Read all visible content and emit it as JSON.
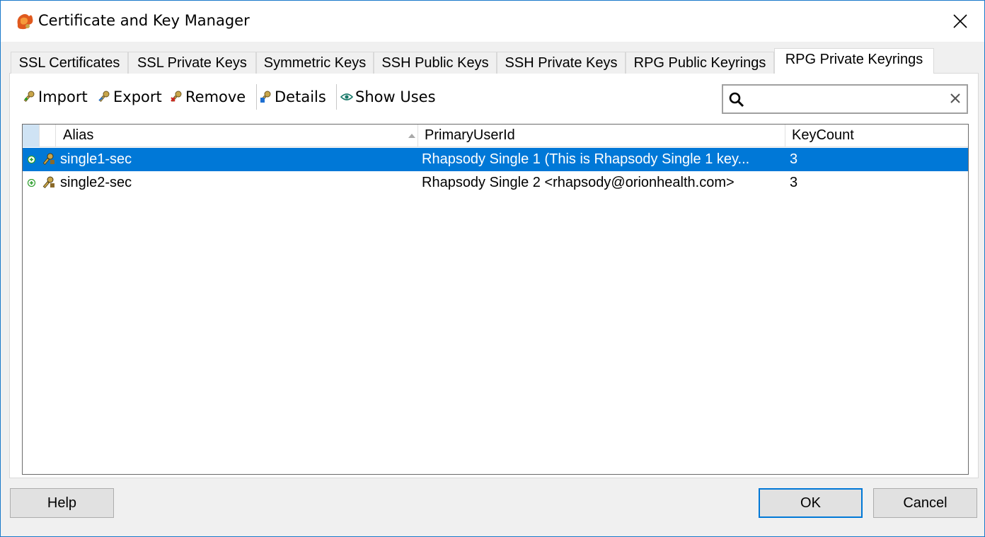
{
  "window": {
    "title": "Certificate and Key Manager",
    "app_icon": "rhapsody-logo-icon",
    "close_icon": "close-icon"
  },
  "tabs": [
    {
      "label": "SSL Certificates",
      "active": false
    },
    {
      "label": "SSL Private Keys",
      "active": false
    },
    {
      "label": "Symmetric Keys",
      "active": false
    },
    {
      "label": "SSH Public Keys",
      "active": false
    },
    {
      "label": "SSH Private Keys",
      "active": false
    },
    {
      "label": "RPG Public Keyrings",
      "active": false
    },
    {
      "label": "RPG Private Keyrings",
      "active": true
    }
  ],
  "toolbar": {
    "import_label": "Import",
    "export_label": "Export",
    "remove_label": "Remove",
    "details_label": "Details",
    "show_uses_label": "Show Uses"
  },
  "search": {
    "value": "",
    "placeholder": "",
    "icon": "search-icon",
    "clear_icon": "clear-icon"
  },
  "table": {
    "columns": [
      "Alias",
      "PrimaryUserId",
      "KeyCount"
    ],
    "sorted_column": "Alias",
    "sort_direction": "ascending",
    "rows": [
      {
        "alias": "single1-sec",
        "primary_user_id": "Rhapsody Single 1 (This is Rhapsody Single 1 key...",
        "key_count": "3",
        "selected": true
      },
      {
        "alias": "single2-sec",
        "primary_user_id": "Rhapsody Single 2 <rhapsody@orionhealth.com>",
        "key_count": "3",
        "selected": false
      }
    ]
  },
  "buttons": {
    "help": "Help",
    "ok": "OK",
    "cancel": "Cancel"
  },
  "colors": {
    "selection": "#0078d7",
    "window_border": "#1979ca",
    "default_button_border": "#0078d7"
  }
}
